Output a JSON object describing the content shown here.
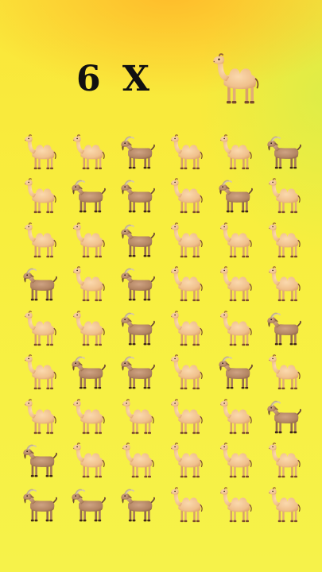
{
  "header": {
    "count_text": "6 X",
    "target_icon": "camel-icon"
  },
  "colors": {
    "background": "#f8ee3e",
    "camel": "#f2c594",
    "goat": "#b88a68"
  },
  "grid": {
    "columns": 6,
    "rows": [
      [
        "camel",
        "camel",
        "goat",
        "camel",
        "camel",
        "goat"
      ],
      [
        "camel",
        "goat",
        "goat",
        "camel",
        "goat",
        "camel"
      ],
      [
        "camel",
        "camel",
        "goat",
        "camel",
        "camel",
        "camel"
      ],
      [
        "goat",
        "camel",
        "goat",
        "camel",
        "camel",
        "camel"
      ],
      [
        "camel",
        "camel",
        "goat",
        "camel",
        "camel",
        "goat"
      ],
      [
        "camel",
        "goat",
        "goat",
        "camel",
        "goat",
        "camel"
      ],
      [
        "camel",
        "camel",
        "camel",
        "camel",
        "camel",
        "goat"
      ],
      [
        "goat",
        "camel",
        "camel",
        "camel",
        "camel",
        "camel"
      ],
      [
        "goat",
        "goat",
        "goat",
        "camel",
        "camel",
        "camel"
      ]
    ]
  }
}
